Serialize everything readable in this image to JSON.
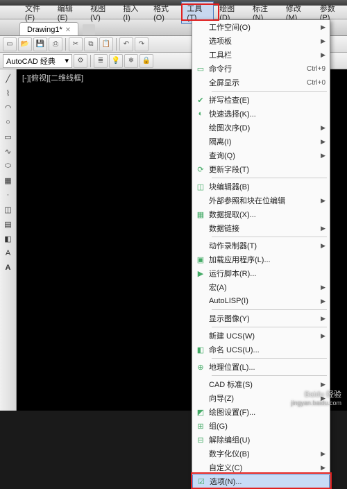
{
  "menubar": {
    "items": [
      "文件(F)",
      "编辑(E)",
      "视图(V)",
      "插入(I)",
      "格式(O)",
      "工具(T)",
      "绘图(D)",
      "标注(N)",
      "修改(M)",
      "参数(P)"
    ],
    "active_index": 5
  },
  "tab": {
    "label": "Drawing1*"
  },
  "workspace": {
    "label": "AutoCAD 经典"
  },
  "viewport": {
    "label": "[-][俯视][二维线框]"
  },
  "dropdown": {
    "groups": [
      [
        {
          "label": "工作空间(O)",
          "arrow": true
        },
        {
          "label": "选项板",
          "arrow": true
        },
        {
          "label": "工具栏",
          "arrow": true
        },
        {
          "label": "命令行",
          "shortcut": "Ctrl+9",
          "icon": "▭"
        },
        {
          "label": "全屏显示",
          "shortcut": "Ctrl+0"
        }
      ],
      [
        {
          "label": "拼写检查(E)",
          "icon": "✔"
        },
        {
          "label": "快速选择(K)...",
          "icon": "◐"
        },
        {
          "label": "绘图次序(D)",
          "arrow": true
        },
        {
          "label": "隔离(I)",
          "arrow": true
        },
        {
          "label": "查询(Q)",
          "arrow": true
        },
        {
          "label": "更新字段(T)",
          "icon": "⟳"
        }
      ],
      [
        {
          "label": "块编辑器(B)",
          "icon": "◫"
        },
        {
          "label": "外部参照和块在位编辑",
          "arrow": true
        },
        {
          "label": "数据提取(X)...",
          "icon": "▦"
        },
        {
          "label": "数据链接",
          "arrow": true
        }
      ],
      [
        {
          "label": "动作录制器(T)",
          "arrow": true
        },
        {
          "label": "加载应用程序(L)...",
          "icon": "▣"
        },
        {
          "label": "运行脚本(R)...",
          "icon": "▶"
        },
        {
          "label": "宏(A)",
          "arrow": true
        },
        {
          "label": "AutoLISP(I)",
          "arrow": true
        }
      ],
      [
        {
          "label": "显示图像(Y)",
          "arrow": true
        }
      ],
      [
        {
          "label": "新建 UCS(W)",
          "arrow": true
        },
        {
          "label": "命名 UCS(U)...",
          "icon": "◧"
        }
      ],
      [
        {
          "label": "地理位置(L)...",
          "icon": "⊕"
        }
      ],
      [
        {
          "label": "CAD 标准(S)",
          "arrow": true
        },
        {
          "label": "向导(Z)",
          "arrow": true
        },
        {
          "label": "绘图设置(F)...",
          "icon": "◩"
        },
        {
          "label": "组(G)",
          "icon": "⊞"
        },
        {
          "label": "解除编组(U)",
          "icon": "⊟"
        },
        {
          "label": "数字化仪(B)",
          "arrow": true
        },
        {
          "label": "自定义(C)",
          "arrow": true
        },
        {
          "label": "选项(N)...",
          "icon": "☑",
          "highlight": true
        }
      ]
    ]
  },
  "watermark": {
    "main": "Baidu 经验",
    "sub": "jingyan.baidu.com"
  },
  "colors": {
    "highlight_red": "#e02020",
    "menu_highlight": "#c8dcf6"
  }
}
